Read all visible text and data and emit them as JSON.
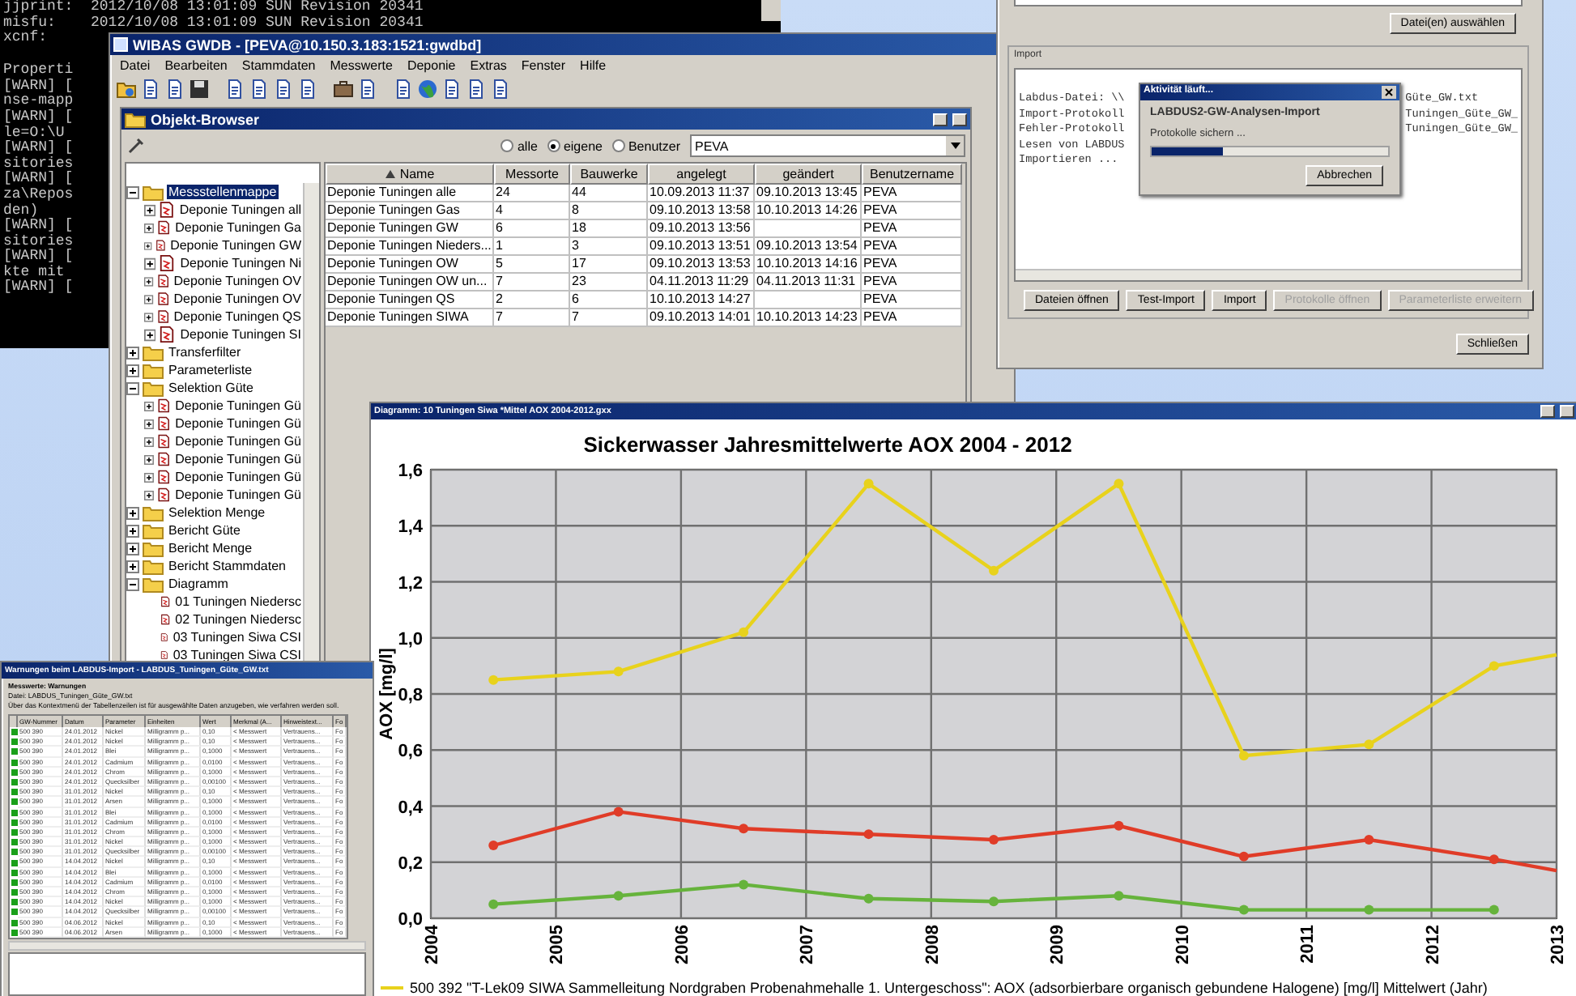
{
  "console": {
    "lines": [
      {
        "text": "jjprint:  2012/10/08 13:01:09 SUN Revision 20341"
      },
      {
        "text": "misfu:    2012/10/08 13:01:09 SUN Revision 20341"
      },
      {
        "text": "xcnf:"
      },
      {
        "text": "Properti",
        "blank_before": true
      },
      {
        "text": "[WARN] ["
      },
      {
        "text": "nse-mapp"
      },
      {
        "text": "[WARN] ["
      },
      {
        "text": "le=O:\\U"
      },
      {
        "text": "[WARN] ["
      },
      {
        "text": "sitories"
      },
      {
        "text": "[WARN] ["
      },
      {
        "text": "za\\Repos"
      },
      {
        "text": "den)"
      },
      {
        "text": "[WARN] ["
      },
      {
        "text": "sitories"
      },
      {
        "text": "[WARN] ["
      },
      {
        "text": "kte mit"
      },
      {
        "text": "[WARN] ["
      }
    ]
  },
  "main_window": {
    "title": "WIBAS GWDB - [PEVA@10.150.3.183:1521:gwdbd]",
    "menu": [
      "Datei",
      "Bearbeiten",
      "Stammdaten",
      "Messwerte",
      "Deponie",
      "Extras",
      "Fenster",
      "Hilfe"
    ]
  },
  "object_browser": {
    "title": "Objekt-Browser",
    "filter_options": [
      {
        "label": "alle",
        "selected": false
      },
      {
        "label": "eigene",
        "selected": true
      },
      {
        "label": "Benutzer",
        "selected": false
      }
    ],
    "user_field": {
      "value": "PEVA"
    },
    "tree": [
      {
        "label": "Messstellenmappe",
        "kind": "folder",
        "expanded": true,
        "selected": true,
        "children": [
          {
            "label": "Deponie Tuningen all",
            "kind": "item",
            "expanded": false,
            "selected": false
          },
          {
            "label": "Deponie Tuningen Ga",
            "kind": "item",
            "expanded": false,
            "selected": false
          },
          {
            "label": "Deponie Tuningen GW",
            "kind": "item",
            "expanded": false,
            "selected": false
          },
          {
            "label": "Deponie Tuningen Ni",
            "kind": "item",
            "expanded": false,
            "selected": false
          },
          {
            "label": "Deponie Tuningen OV",
            "kind": "item",
            "expanded": false,
            "selected": false
          },
          {
            "label": "Deponie Tuningen OV",
            "kind": "item",
            "expanded": false,
            "selected": false
          },
          {
            "label": "Deponie Tuningen QS",
            "kind": "item",
            "expanded": false,
            "selected": false
          },
          {
            "label": "Deponie Tuningen SI",
            "kind": "item",
            "expanded": false,
            "selected": false
          }
        ]
      },
      {
        "label": "Transferfilter",
        "kind": "folder",
        "expanded": false,
        "selected": false
      },
      {
        "label": "Parameterliste",
        "kind": "folder",
        "expanded": false,
        "selected": false
      },
      {
        "label": "Selektion Güte",
        "kind": "folder",
        "expanded": true,
        "selected": false,
        "children": [
          {
            "label": "Deponie Tuningen Gü",
            "kind": "item",
            "expanded": false,
            "selected": false
          },
          {
            "label": "Deponie Tuningen Gü",
            "kind": "item",
            "expanded": false,
            "selected": false
          },
          {
            "label": "Deponie Tuningen Gü",
            "kind": "item",
            "expanded": false,
            "selected": false
          },
          {
            "label": "Deponie Tuningen Gü",
            "kind": "item",
            "expanded": false,
            "selected": false
          },
          {
            "label": "Deponie Tuningen Gü",
            "kind": "item",
            "expanded": false,
            "selected": false
          },
          {
            "label": "Deponie Tuningen Gü",
            "kind": "item",
            "expanded": false,
            "selected": false
          }
        ]
      },
      {
        "label": "Selektion Menge",
        "kind": "folder",
        "expanded": false,
        "selected": false
      },
      {
        "label": "Bericht Güte",
        "kind": "folder",
        "expanded": false,
        "selected": false
      },
      {
        "label": "Bericht Menge",
        "kind": "folder",
        "expanded": false,
        "selected": false
      },
      {
        "label": "Bericht Stammdaten",
        "kind": "folder",
        "expanded": false,
        "selected": false
      },
      {
        "label": "Diagramm",
        "kind": "folder",
        "expanded": true,
        "selected": false,
        "children": [
          {
            "label": "01 Tuningen Niedersc",
            "kind": "item",
            "selected": false
          },
          {
            "label": "02 Tuningen Niedersc",
            "kind": "item",
            "selected": false
          },
          {
            "label": "03 Tuningen Siwa CSI",
            "kind": "item",
            "selected": false
          },
          {
            "label": "03 Tuningen Siwa CSI",
            "kind": "item",
            "selected": false
          }
        ]
      }
    ],
    "table": {
      "columns": [
        "Name",
        "Messorte",
        "Bauwerke",
        "angelegt",
        "geändert",
        "Benutzername"
      ],
      "rows": [
        [
          "Deponie Tuningen alle",
          "24",
          "44",
          "10.09.2013 11:37",
          "09.10.2013 13:45",
          "PEVA"
        ],
        [
          "Deponie Tuningen Gas",
          "4",
          "8",
          "09.10.2013 13:58",
          "10.10.2013 14:26",
          "PEVA"
        ],
        [
          "Deponie Tuningen GW",
          "6",
          "18",
          "09.10.2013 13:56",
          "",
          "PEVA"
        ],
        [
          "Deponie Tuningen Nieders...",
          "1",
          "3",
          "09.10.2013 13:51",
          "09.10.2013 13:54",
          "PEVA"
        ],
        [
          "Deponie Tuningen OW",
          "5",
          "17",
          "09.10.2013 13:53",
          "10.10.2013 14:16",
          "PEVA"
        ],
        [
          "Deponie Tuningen OW un...",
          "7",
          "23",
          "04.11.2013 11:29",
          "04.11.2013 11:31",
          "PEVA"
        ],
        [
          "Deponie Tuningen QS",
          "2",
          "6",
          "10.10.2013 14:27",
          "",
          "PEVA"
        ],
        [
          "Deponie Tuningen SIWA",
          "7",
          "7",
          "09.10.2013 14:01",
          "10.10.2013 14:23",
          "PEVA"
        ]
      ]
    }
  },
  "import_dialog": {
    "select_button": "Datei(en) auswählen",
    "group_label": "Import",
    "log_lines": [
      "Labdus-Datei: \\\\",
      "Import-Protokoll",
      "Fehler-Protokoll",
      "Lesen von LABDUS",
      "Importieren ..."
    ],
    "log_tails": [
      "Güte_GW.txt",
      "Tuningen_Güte_GW_",
      "Tuningen_Güte_GW_"
    ],
    "buttons": [
      {
        "label": "Dateien öffnen",
        "disabled": false
      },
      {
        "label": "Test-Import",
        "disabled": false
      },
      {
        "label": "Import",
        "disabled": false
      },
      {
        "label": "Protokolle öffnen",
        "disabled": true
      },
      {
        "label": "Parameterliste erweitern",
        "disabled": true
      }
    ],
    "close_button": "Schließen"
  },
  "progress_popup": {
    "title": "Aktivität läuft...",
    "heading": "LABDUS2-GW-Analysen-Import",
    "status": "Protokolle sichern ...",
    "level": 0.3,
    "cancel_button": "Abbrechen"
  },
  "chart_window": {
    "title": "Diagramm: 10 Tuningen Siwa *Mittel AOX 2004-2012.gxx",
    "legend": [
      {
        "label": "500 392 \"T-Lek09 SIWA Sammelleitung Nordgraben Probenahmehalle 1. Untergeschoss\": AOX (adsorbierbare organisch gebundene Halogene) [mg/l] Mittelwert (Jahr)",
        "color": "#e8d21c"
      }
    ],
    "chart_data": {
      "type": "line",
      "grid": true,
      "title": "Sickerwasser Jahresmittelwerte AOX 2004 - 2012",
      "ylabel": "AOX [mg/l]",
      "x": [
        2004.5,
        2005.5,
        2006.5,
        2007.5,
        2008.5,
        2009.5,
        2010.5,
        2011.5,
        2012.5,
        2013
      ],
      "series": [
        {
          "color": "#e8d21c",
          "marker": true,
          "values": [
            0.85,
            0.88,
            1.02,
            1.55,
            1.24,
            1.55,
            0.58,
            0.62,
            0.9,
            0.94
          ]
        },
        {
          "color": "#e03c28",
          "marker": true,
          "values": [
            0.26,
            0.38,
            0.32,
            0.3,
            0.28,
            0.33,
            0.22,
            0.28,
            0.21,
            0.17
          ]
        },
        {
          "color": "#66b33c",
          "marker": true,
          "values": [
            0.05,
            0.08,
            0.12,
            0.07,
            0.06,
            0.08,
            0.03,
            0.03,
            0.03,
            null
          ]
        }
      ],
      "xlim": [
        2004,
        2013
      ],
      "ylim": [
        0,
        1.6
      ],
      "xticks": [
        2004,
        2005,
        2006,
        2007,
        2008,
        2009,
        2010,
        2011,
        2012,
        2013
      ],
      "yticks": [
        {
          "value": 0,
          "label": "0,0"
        },
        {
          "value": 0.2,
          "label": "0,2"
        },
        {
          "value": 0.4,
          "label": "0,4"
        },
        {
          "value": 0.6,
          "label": "0,6"
        },
        {
          "value": 0.8,
          "label": "0,8"
        },
        {
          "value": 1,
          "label": "1,0"
        },
        {
          "value": 1.2,
          "label": "1,2"
        },
        {
          "value": 1.4,
          "label": "1,4"
        },
        {
          "value": 1.6,
          "label": "1,6"
        }
      ]
    }
  },
  "warnings_window": {
    "title": "Warnungen beim LABDUS-Import - LABDUS_Tuningen_Güte_GW.txt",
    "heading": "Messwerte: Warnungen",
    "file": "Datei: LABDUS_Tuningen_Güte_GW.txt",
    "hint": "Über das Kontextmenü der Tabellenzeilen ist für ausgewählte Daten anzugeben, wie verfahren werden soll.",
    "columns": [
      "GW-Nummer",
      "Datum",
      "Parameter",
      "Einheiten",
      "Wert",
      "Merkmal (A...",
      "Hinweistext...",
      "Fo"
    ],
    "rows": [
      [
        "500 390",
        "24.01.2012",
        "Nickel",
        "Milligramm p...",
        "0,10",
        "< Messwert",
        "Vertrauens...",
        "Fo"
      ],
      [
        "500 390",
        "24.01.2012",
        "Nickel",
        "Milligramm p...",
        "0,10",
        "< Messwert",
        "Vertrauens...",
        "Fo"
      ],
      [
        "500 390",
        "24.01.2012",
        "Blei",
        "Milligramm p...",
        "0,1000",
        "< Messwert",
        "Vertrauens...",
        "Fo"
      ],
      [
        "500 390",
        "24.01.2012",
        "Cadmium",
        "Milligramm p...",
        "0,0100",
        "< Messwert",
        "Vertrauens...",
        "Fo"
      ],
      [
        "500 390",
        "24.01.2012",
        "Chrom",
        "Milligramm p...",
        "0,1000",
        "< Messwert",
        "Vertrauens...",
        "Fo"
      ],
      [
        "500 390",
        "24.01.2012",
        "Quecksilber",
        "Milligramm p...",
        "0,00100",
        "< Messwert",
        "Vertrauens...",
        "Fo"
      ],
      [
        "500 390",
        "31.01.2012",
        "Nickel",
        "Milligramm p...",
        "0,10",
        "< Messwert",
        "Vertrauens...",
        "Fo"
      ],
      [
        "500 390",
        "31.01.2012",
        "Arsen",
        "Milligramm p...",
        "0,1000",
        "< Messwert",
        "Vertrauens...",
        "Fo"
      ],
      [
        "500 390",
        "31.01.2012",
        "Blei",
        "Milligramm p...",
        "0,1000",
        "< Messwert",
        "Vertrauens...",
        "Fo"
      ],
      [
        "500 390",
        "31.01.2012",
        "Cadmium",
        "Milligramm p...",
        "0,0100",
        "< Messwert",
        "Vertrauens...",
        "Fo"
      ],
      [
        "500 390",
        "31.01.2012",
        "Chrom",
        "Milligramm p...",
        "0,1000",
        "< Messwert",
        "Vertrauens...",
        "Fo"
      ],
      [
        "500 390",
        "31.01.2012",
        "Nickel",
        "Milligramm p...",
        "0,1000",
        "< Messwert",
        "Vertrauens...",
        "Fo"
      ],
      [
        "500 390",
        "31.01.2012",
        "Quecksilber",
        "Milligramm p...",
        "0,00100",
        "< Messwert",
        "Vertrauens...",
        "Fo"
      ],
      [
        "500 390",
        "14.04.2012",
        "Nickel",
        "Milligramm p...",
        "0,10",
        "< Messwert",
        "Vertrauens...",
        "Fo"
      ],
      [
        "500 390",
        "14.04.2012",
        "Blei",
        "Milligramm p...",
        "0,1000",
        "< Messwert",
        "Vertrauens...",
        "Fo"
      ],
      [
        "500 390",
        "14.04.2012",
        "Cadmium",
        "Milligramm p...",
        "0,0100",
        "< Messwert",
        "Vertrauens...",
        "Fo"
      ],
      [
        "500 390",
        "14.04.2012",
        "Chrom",
        "Milligramm p...",
        "0,1000",
        "< Messwert",
        "Vertrauens...",
        "Fo"
      ],
      [
        "500 390",
        "14.04.2012",
        "Nickel",
        "Milligramm p...",
        "0,1000",
        "< Messwert",
        "Vertrauens...",
        "Fo"
      ],
      [
        "500 390",
        "14.04.2012",
        "Quecksilber",
        "Milligramm p...",
        "0,00100",
        "< Messwert",
        "Vertrauens...",
        "Fo"
      ],
      [
        "500 390",
        "04.06.2012",
        "Nickel",
        "Milligramm p...",
        "0,10",
        "< Messwert",
        "Vertrauens...",
        "Fo"
      ],
      [
        "500 390",
        "04.06.2012",
        "Arsen",
        "Milligramm p...",
        "0,1000",
        "< Messwert",
        "Vertrauens...",
        "Fo"
      ]
    ]
  }
}
